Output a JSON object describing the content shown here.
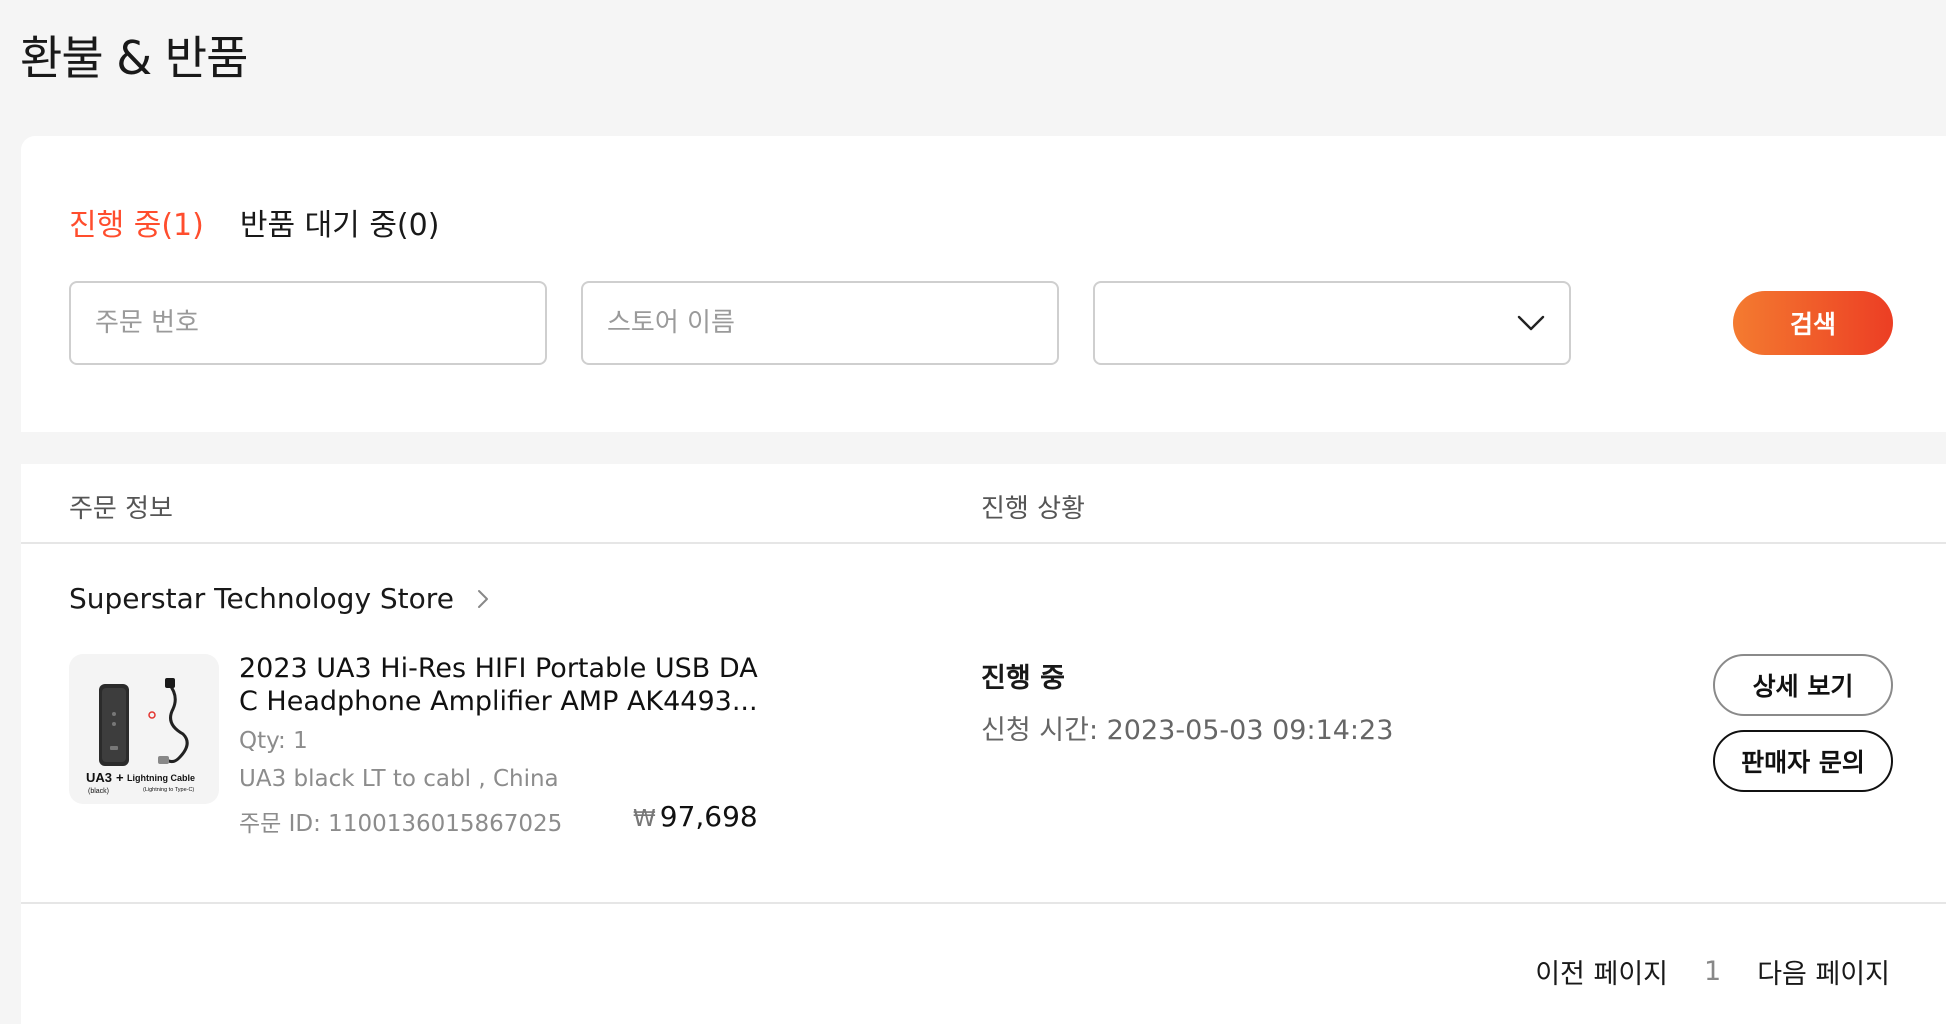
{
  "page": {
    "title": "환불 & 반품"
  },
  "tabs": [
    {
      "label": "진행 중(1)",
      "active": true
    },
    {
      "label": "반품 대기 중(0)",
      "active": false
    }
  ],
  "filters": {
    "order_number_placeholder": "주문 번호",
    "store_name_placeholder": "스토어 이름",
    "status_select_value": "",
    "search_label": "검색"
  },
  "columns": {
    "order_info": "주문 정보",
    "progress": "진행 상황"
  },
  "order": {
    "store_name": "Superstar Technology Store",
    "product_title": "2023 UA3 Hi-Res HIFI Portable USB DAC Headphone Amplifier AMP AK4493...",
    "qty": "Qty: 1",
    "sku": "UA3 black LT to cabl , China",
    "order_id": "주문 ID: 1100136015867025",
    "currency_symbol": "₩",
    "price": "97,698",
    "status": "진행 중",
    "applied_time": "신청 시간: 2023-05-03 09:14:23",
    "detail_button": "상세 보기",
    "contact_button": "판매자 문의",
    "thumbnail": {
      "model": "UA3",
      "color": "(black)",
      "cable": "Lightning Cable",
      "cable_sub": "(Lightning to Type-C)"
    }
  },
  "pagination": {
    "prev": "이전 페이지",
    "current": "1",
    "next": "다음 페이지"
  },
  "colors": {
    "accent": "#ff4d2d",
    "button_gradient_start": "#f47b30",
    "button_gradient_end": "#ec3e24"
  }
}
